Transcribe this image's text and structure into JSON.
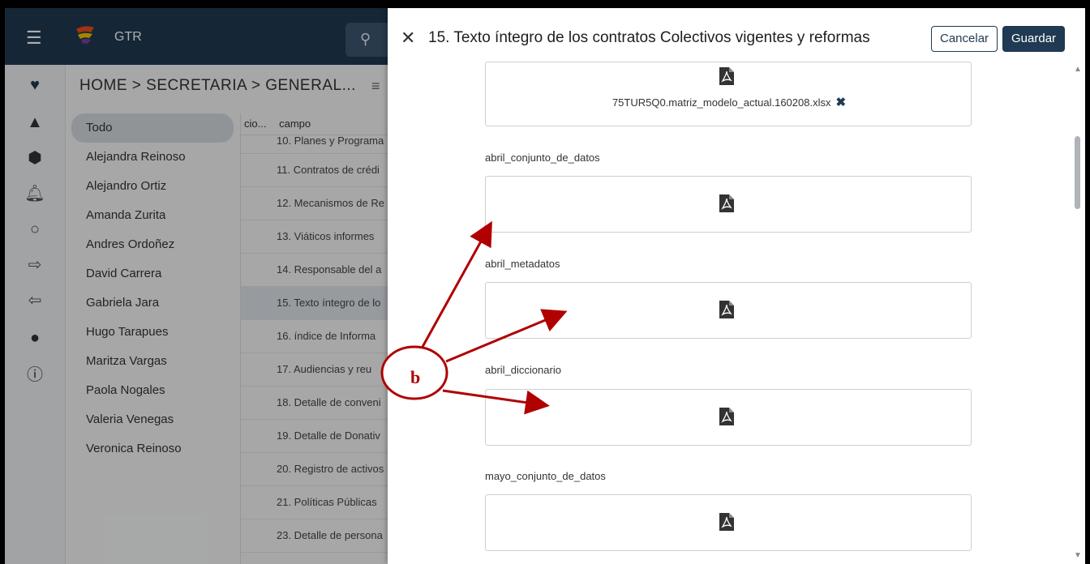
{
  "app": {
    "title": "GTR",
    "breadcrumb": "HOME > SECRETARIA > GENERAL...",
    "people": [
      "Todo",
      "Alejandra Reinoso",
      "Alejandro Ortiz",
      "Amanda Zurita",
      "Andres Ordoñez",
      "David Carrera",
      "Gabriela Jara",
      "Hugo Tarapues",
      "Maritza Vargas",
      "Paola Nogales",
      "Valeria Venegas",
      "Veronica Reinoso"
    ],
    "columns": {
      "col1": "cio...",
      "col2": "campo"
    },
    "rows": [
      "10. Planes y Programa",
      "11. Contratos de crédi",
      "12. Mecanismos de Re",
      "13. Viáticos informes",
      "14. Responsable del a",
      "15. Texto íntegro de lo",
      "16. índice de Informa",
      "17. Audiencias y reu",
      "18. Detalle de conveni",
      "19. Detalle de Donativ",
      "20. Registro de activos",
      "21. Políticas Públicas",
      "23. Detalle de persona"
    ]
  },
  "modal": {
    "title": "15. Texto íntegro de los contratos Colectivos vigentes y reformas",
    "cancel": "Cancelar",
    "save": "Guardar",
    "file_name": "75TUR5Q0.matriz_modelo_actual.160208.xlsx",
    "fields": [
      "abril_conjunto_de_datos",
      "abril_metadatos",
      "abril_diccionario",
      "mayo_conjunto_de_datos"
    ]
  },
  "annotation": {
    "label": "b",
    "color": "#b00000"
  },
  "colors": {
    "brand": "#1f3a52"
  }
}
